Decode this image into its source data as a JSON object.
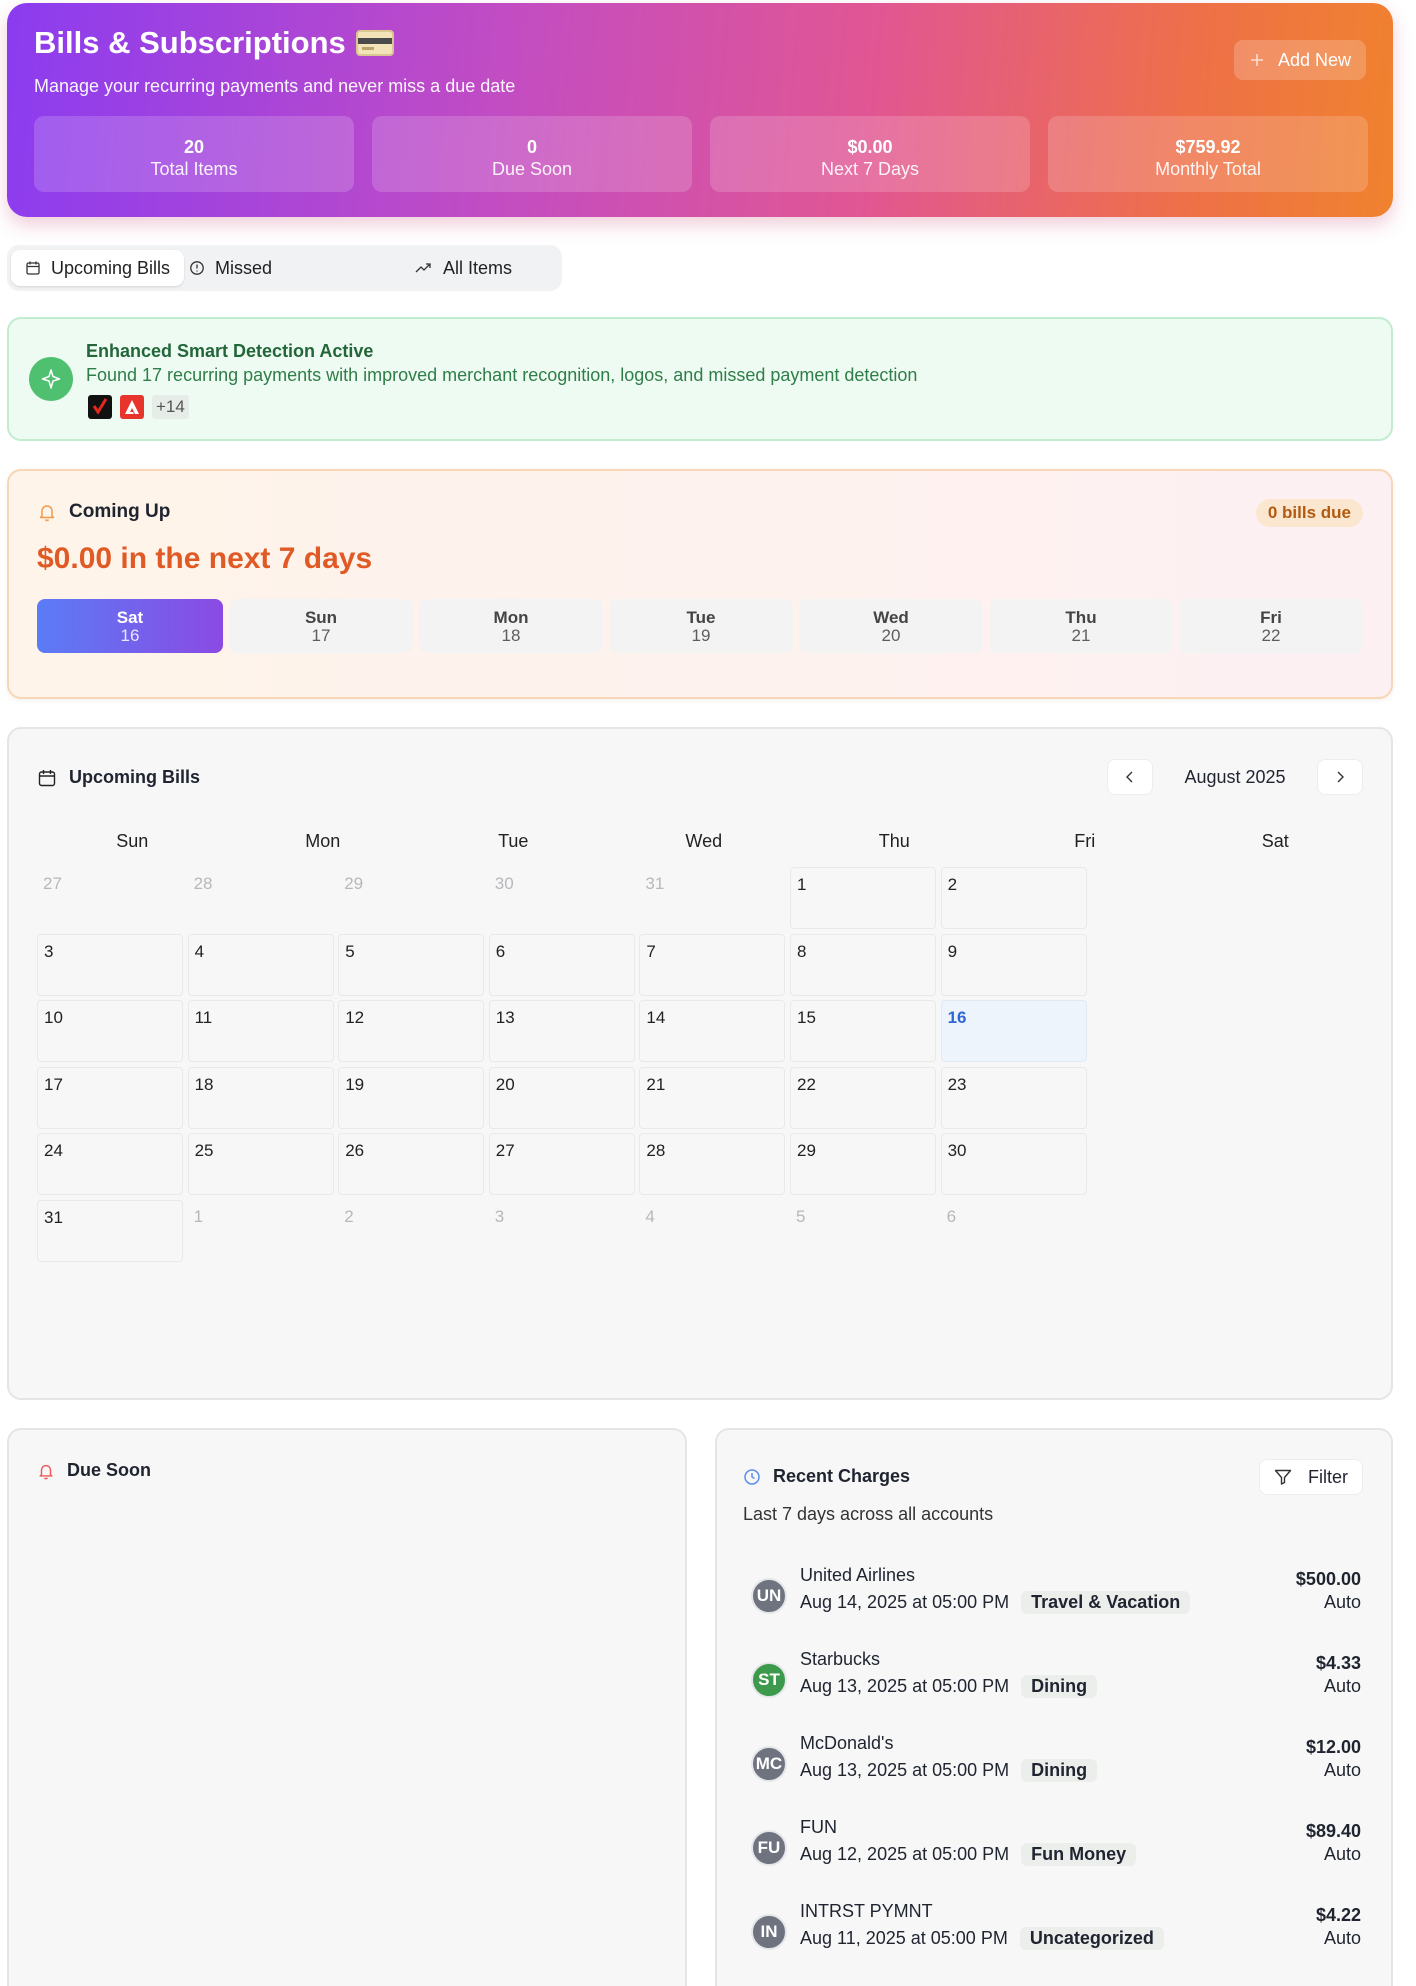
{
  "header": {
    "title": "Bills & Subscriptions",
    "title_icon": "credit-card-icon",
    "subtitle": "Manage your recurring payments and never miss a due date",
    "add_label": "Add New",
    "gradient": [
      "#8b3cf0",
      "#e15693",
      "#f0822e"
    ],
    "stats": [
      {
        "value": "20",
        "label": "Total Items"
      },
      {
        "value": "0",
        "label": "Due Soon"
      },
      {
        "value": "$0.00",
        "label": "Next 7 Days"
      },
      {
        "value": "$759.92",
        "label": "Monthly Total"
      }
    ]
  },
  "tabs": [
    {
      "label": "Upcoming Bills",
      "icon": "calendar-icon",
      "active": true
    },
    {
      "label": "Missed",
      "icon": "alert-circle-icon",
      "active": false
    },
    {
      "label": "All Items",
      "icon": "trending-up-icon",
      "active": false
    }
  ],
  "smart": {
    "title": "Enhanced Smart Detection Active",
    "description": "Found 17 recurring payments with improved merchant recognition, logos, and missed payment detection",
    "more": "+14",
    "accent": "#4fc06f"
  },
  "coming_up": {
    "title": "Coming Up",
    "badge": "0 bills due",
    "amount_text": "$0.00 in the next 7 days",
    "accent": "#e05a26",
    "days": [
      {
        "name": "Sat",
        "num": "16",
        "selected": true
      },
      {
        "name": "Sun",
        "num": "17"
      },
      {
        "name": "Mon",
        "num": "18"
      },
      {
        "name": "Tue",
        "num": "19"
      },
      {
        "name": "Wed",
        "num": "20"
      },
      {
        "name": "Thu",
        "num": "21"
      },
      {
        "name": "Fri",
        "num": "22"
      }
    ]
  },
  "calendar": {
    "title": "Upcoming Bills",
    "month": "August 2025",
    "weekdays": [
      "Sun",
      "Mon",
      "Tue",
      "Wed",
      "Thu",
      "Fri",
      "Sat"
    ],
    "today": "16",
    "weeks": [
      [
        [
          "27",
          0
        ],
        [
          "28",
          0
        ],
        [
          "29",
          0
        ],
        [
          "30",
          0
        ],
        [
          "31",
          0
        ],
        [
          "1",
          1
        ],
        [
          "2",
          1
        ]
      ],
      [
        [
          "3",
          1
        ],
        [
          "4",
          1
        ],
        [
          "5",
          1
        ],
        [
          "6",
          1
        ],
        [
          "7",
          1
        ],
        [
          "8",
          1
        ],
        [
          "9",
          1
        ]
      ],
      [
        [
          "10",
          1
        ],
        [
          "11",
          1
        ],
        [
          "12",
          1
        ],
        [
          "13",
          1
        ],
        [
          "14",
          1
        ],
        [
          "15",
          1
        ],
        [
          "16",
          1
        ]
      ],
      [
        [
          "17",
          1
        ],
        [
          "18",
          1
        ],
        [
          "19",
          1
        ],
        [
          "20",
          1
        ],
        [
          "21",
          1
        ],
        [
          "22",
          1
        ],
        [
          "23",
          1
        ]
      ],
      [
        [
          "24",
          1
        ],
        [
          "25",
          1
        ],
        [
          "26",
          1
        ],
        [
          "27",
          1
        ],
        [
          "28",
          1
        ],
        [
          "29",
          1
        ],
        [
          "30",
          1
        ]
      ],
      [
        [
          "31",
          1
        ],
        [
          "1",
          0
        ],
        [
          "2",
          0
        ],
        [
          "3",
          0
        ],
        [
          "4",
          0
        ],
        [
          "5",
          0
        ],
        [
          "6",
          0
        ]
      ]
    ]
  },
  "due_soon": {
    "title": "Due Soon"
  },
  "recent": {
    "title": "Recent Charges",
    "filter_label": "Filter",
    "subtitle": "Last 7 days across all accounts",
    "items": [
      {
        "initials": "UN",
        "name": "United Airlines",
        "date": "Aug 14, 2025 at 05:00 PM",
        "category": "Travel & Vacation",
        "amount": "$500.00",
        "type": "Auto",
        "color": "#6f7380"
      },
      {
        "initials": "ST",
        "name": "Starbucks",
        "date": "Aug 13, 2025 at 05:00 PM",
        "category": "Dining",
        "amount": "$4.33",
        "type": "Auto",
        "color": "#3d9a4c"
      },
      {
        "initials": "MC",
        "name": "McDonald's",
        "date": "Aug 13, 2025 at 05:00 PM",
        "category": "Dining",
        "amount": "$12.00",
        "type": "Auto",
        "color": "#6f7380"
      },
      {
        "initials": "FU",
        "name": "FUN",
        "date": "Aug 12, 2025 at 05:00 PM",
        "category": "Fun Money",
        "amount": "$89.40",
        "type": "Auto",
        "color": "#6f7380"
      },
      {
        "initials": "IN",
        "name": "INTRST PYMNT",
        "date": "Aug 11, 2025 at 05:00 PM",
        "category": "Uncategorized",
        "amount": "$4.22",
        "type": "Auto",
        "color": "#6f7380"
      }
    ]
  }
}
